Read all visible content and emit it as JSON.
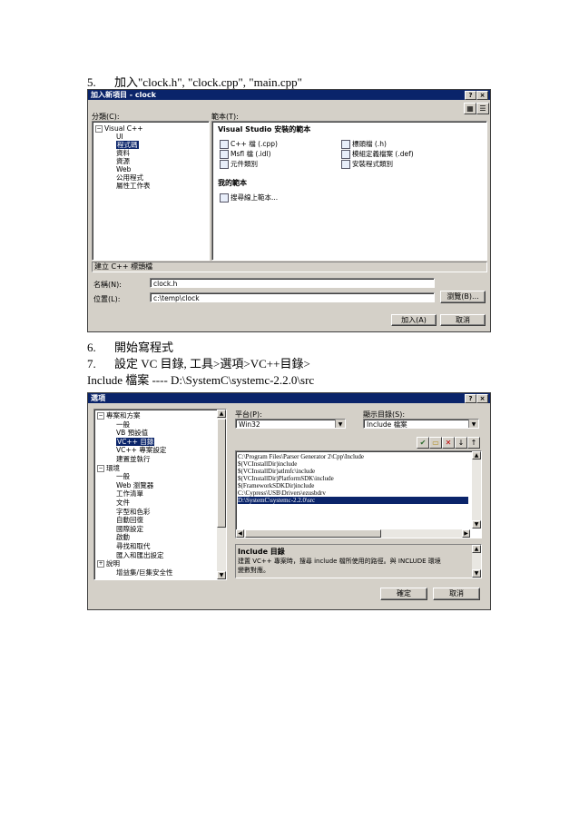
{
  "doc": {
    "step5_num": "5.",
    "step5_text": "加入\"clock.h\", \"clock.cpp\", \"main.cpp\"",
    "step6_num": "6.",
    "step6_text": "開始寫程式",
    "step7_num": "7.",
    "step7_text": "設定 VC 目錄, 工具>選項>VC++目錄>",
    "include_line": "Include 檔案  ---- D:\\SystemC\\systemc-2.2.0\\src"
  },
  "dialog1": {
    "title": "加入新項目 - clock",
    "help_btn": "?",
    "close_btn": "×",
    "category_label": "分類(C):",
    "template_label": "範本(T):",
    "tree": [
      {
        "label": "Visual C++",
        "pm": "−",
        "level": 0
      },
      {
        "label": "UI",
        "level": 1
      },
      {
        "label": "程式碼",
        "level": 1,
        "selected": true
      },
      {
        "label": "資料",
        "level": 1
      },
      {
        "label": "資源",
        "level": 1
      },
      {
        "label": "Web",
        "level": 1
      },
      {
        "label": "公用程式",
        "level": 1
      },
      {
        "label": "屬性工作表",
        "level": 1
      }
    ],
    "installed_header": "Visual Studio 安裝的範本",
    "templates_left": [
      "C++ 檔 (.cpp)",
      "Msfl 檔 (.idl)",
      "元件類別"
    ],
    "templates_right": [
      "標頭檔 (.h)",
      "模組定義檔案 (.def)",
      "安裝程式類別"
    ],
    "my_templates_header": "我的範本",
    "my_templates": [
      "搜尋線上範本..."
    ],
    "description": "建立 C++ 標頭檔",
    "name_label": "名稱(N):",
    "name_value": "clock.h",
    "location_label": "位置(L):",
    "location_value": "c:\\temp\\clock",
    "browse_btn": "瀏覽(B)...",
    "add_btn": "加入(A)",
    "cancel_btn": "取消"
  },
  "dialog2": {
    "title": "選項",
    "help_btn": "?",
    "close_btn": "×",
    "tree": [
      {
        "label": "專案和方案",
        "pm": "−",
        "level": 0
      },
      {
        "label": "一般",
        "level": 1
      },
      {
        "label": "VB 預設值",
        "level": 1
      },
      {
        "label": "VC++ 目錄",
        "level": 1,
        "selected": true
      },
      {
        "label": "VC++ 專案設定",
        "level": 1
      },
      {
        "label": "建置並執行",
        "level": 1
      },
      {
        "label": "環境",
        "pm": "−",
        "level": 0
      },
      {
        "label": "一般",
        "level": 1
      },
      {
        "label": "Web 瀏覽器",
        "level": 1
      },
      {
        "label": "工作清單",
        "level": 1
      },
      {
        "label": "文件",
        "level": 1
      },
      {
        "label": "字型和色彩",
        "level": 1
      },
      {
        "label": "自動回復",
        "level": 1
      },
      {
        "label": "國際設定",
        "level": 1
      },
      {
        "label": "啟動",
        "level": 1
      },
      {
        "label": "尋找和取代",
        "level": 1
      },
      {
        "label": "匯入和匯出設定",
        "level": 1
      },
      {
        "label": "說明",
        "pm": "+",
        "level": 0
      },
      {
        "label": "增益集/巨集安全性",
        "level": 1
      }
    ],
    "platform_label": "平台(P):",
    "platform_value": "Win32",
    "show_dirs_label": "顯示目錄(S):",
    "show_dirs_value": "Include 檔案",
    "paths": [
      "C:\\Program Files\\Parser Generator 2\\Cpp\\Include",
      "$(VCInstallDir)include",
      "$(VCInstallDir)atlmfc\\include",
      "$(VCInstallDir)PlatformSDK\\include",
      "$(FrameworkSDKDir)include",
      "C:\\Cypress\\USB\\Drivers\\ezusbdrv",
      "D:\\SystemC\\systemc-2.2.0\\src"
    ],
    "selected_path_index": 6,
    "desc_title": "Include 目錄",
    "desc_text_1": "建置 VC++ 專案時，搜尋 include 檔所使用的路徑。與 INCLUDE 環境",
    "desc_text_2": "變數對應。",
    "ok_btn": "確定",
    "cancel_btn": "取消",
    "tool_icons": [
      "checkmark-icon",
      "new-folder-icon",
      "delete-icon",
      "move-down-icon",
      "move-up-icon"
    ]
  }
}
